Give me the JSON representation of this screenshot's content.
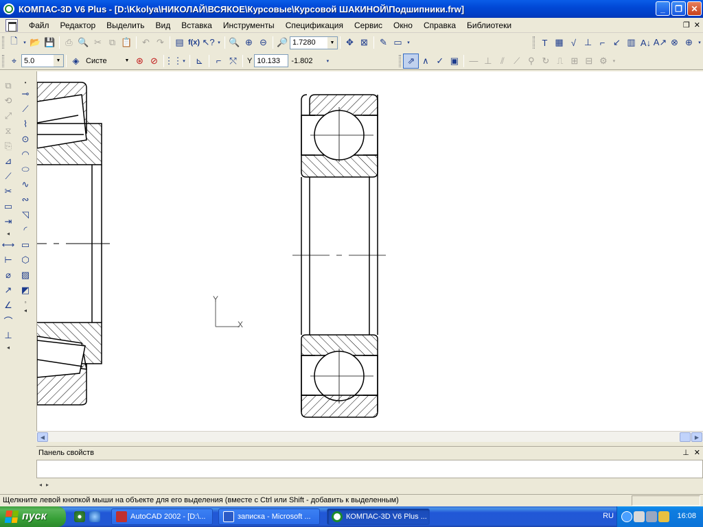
{
  "window": {
    "title": "КОМПАС-3D V6 Plus - [D:\\Kkolya\\НИКОЛАЙ\\ВСЯКОЕ\\Курсовые\\Курсовой ШАКИНОЙ\\Подшипники.frw]",
    "minimize": "_",
    "maximize": "❐",
    "close": "✕"
  },
  "menu": {
    "items": [
      "Файл",
      "Редактор",
      "Выделить",
      "Вид",
      "Вставка",
      "Инструменты",
      "Спецификация",
      "Сервис",
      "Окно",
      "Справка",
      "Библиотеки"
    ],
    "mdi_restore": "❐",
    "mdi_close": "✕"
  },
  "toolbar1": {
    "zoom_value": "1.7280"
  },
  "toolbar2": {
    "step_value": "5.0",
    "layer_label": "Систе",
    "coord_label": "Y",
    "coord_x": "10.133",
    "coord_y": "-1.802"
  },
  "canvas": {
    "axis_y_label": "Y",
    "axis_x_label": "X"
  },
  "props_panel": {
    "title": "Панель свойств",
    "pin": "ᵖ",
    "close": "✕"
  },
  "status": {
    "text": "Щелкните левой кнопкой мыши на объекте для его выделения (вместе с Ctrl или Shift - добавить к выделенным)"
  },
  "taskbar": {
    "start_label": "пуск",
    "tasks": [
      {
        "label": "AutoCAD 2002 - [D:\\..."
      },
      {
        "label": "записка - Microsoft ..."
      },
      {
        "label": "КОМПАС-3D V6 Plus ..."
      }
    ],
    "language": "RU",
    "time": "16:08"
  },
  "colors": {
    "titlebar": "#0148d6",
    "taskbar": "#2157d7",
    "start": "#37a037",
    "drawing_line": "#000000"
  }
}
